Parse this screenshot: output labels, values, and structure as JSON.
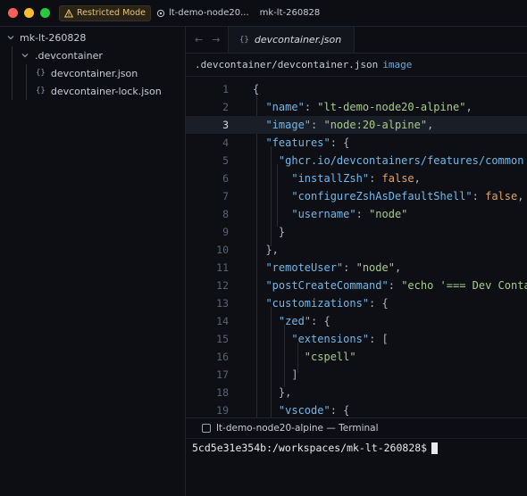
{
  "titlebar": {
    "restricted_label": "Restricted Mode",
    "project_label": "lt-demo-node20...",
    "branch_label": "mk-lt-260828"
  },
  "sidebar": {
    "root": "mk-lt-260828",
    "folder": ".devcontainer",
    "files": [
      "devcontainer.json",
      "devcontainer-lock.json"
    ],
    "file_icon": "{}"
  },
  "editor": {
    "nav_back": "←",
    "nav_forward": "→",
    "tab_label": "devcontainer.json",
    "tab_icon": "{}",
    "breadcrumb_path": ".devcontainer/devcontainer.json",
    "breadcrumb_symbol": "image",
    "active_line": 3,
    "line_numbers": [
      "1",
      "2",
      "3",
      "4",
      "5",
      "6",
      "7",
      "8",
      "9",
      "10",
      "11",
      "12",
      "13",
      "14",
      "15",
      "16",
      "17",
      "18",
      "19"
    ]
  },
  "code": {
    "l1_open": "{",
    "l2_key": "\"name\"",
    "l2_val": "\"lt-demo-node20-alpine\"",
    "l3_key": "\"image\"",
    "l3_val": "\"node:20-alpine\"",
    "l4_key": "\"features\"",
    "l5_key": "\"ghcr.io/devcontainers/features/common",
    "l6_key": "\"installZsh\"",
    "l6_val": "false",
    "l7_key": "\"configureZshAsDefaultShell\"",
    "l7_val": "false",
    "l8_key": "\"username\"",
    "l8_val": "\"node\"",
    "l9_close": "}",
    "l10_close": "},",
    "l11_key": "\"remoteUser\"",
    "l11_val": "\"node\"",
    "l12_key": "\"postCreateCommand\"",
    "l12_val": "\"echo '=== Dev Conta",
    "l13_key": "\"customizations\"",
    "l14_key": "\"zed\"",
    "l15_key": "\"extensions\"",
    "l16_val": "\"cspell\"",
    "l17_close": "]",
    "l18_close": "},",
    "l19_key": "\"vscode\""
  },
  "terminal": {
    "tab_label": "lt-demo-node20-alpine — Terminal",
    "prompt": "5cd5e31e354b:/workspaces/mk-lt-260828$"
  },
  "colors": {
    "key": "#73b8e8",
    "string": "#a8cc8c",
    "boolean": "#e0a567",
    "restricted": "#e8c670"
  }
}
